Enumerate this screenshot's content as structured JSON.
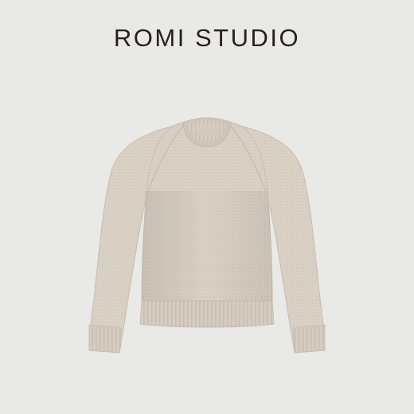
{
  "brand": {
    "name": "ROMI STUDIO"
  },
  "product": {
    "type": "knit crew-neck sweater",
    "color": "#d8cfc2"
  }
}
